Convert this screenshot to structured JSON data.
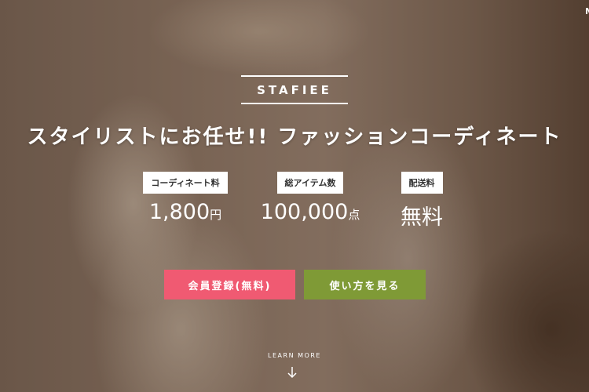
{
  "corner_text": "M",
  "logo": "STAFIEE",
  "headline": "スタイリストにお任せ!! ファッションコーディネート",
  "stats": [
    {
      "label": "コーディネート料",
      "value": "1,800",
      "unit": "円"
    },
    {
      "label": "総アイテム数",
      "value": "100,000",
      "unit": "点"
    },
    {
      "label": "配送料",
      "value": "無料",
      "unit": ""
    }
  ],
  "buttons": {
    "register": "会員登録(無料)",
    "howto": "使い方を見る"
  },
  "learn_more": "LEARN MORE",
  "colors": {
    "register": "#f05a72",
    "howto": "#7f9a36"
  }
}
